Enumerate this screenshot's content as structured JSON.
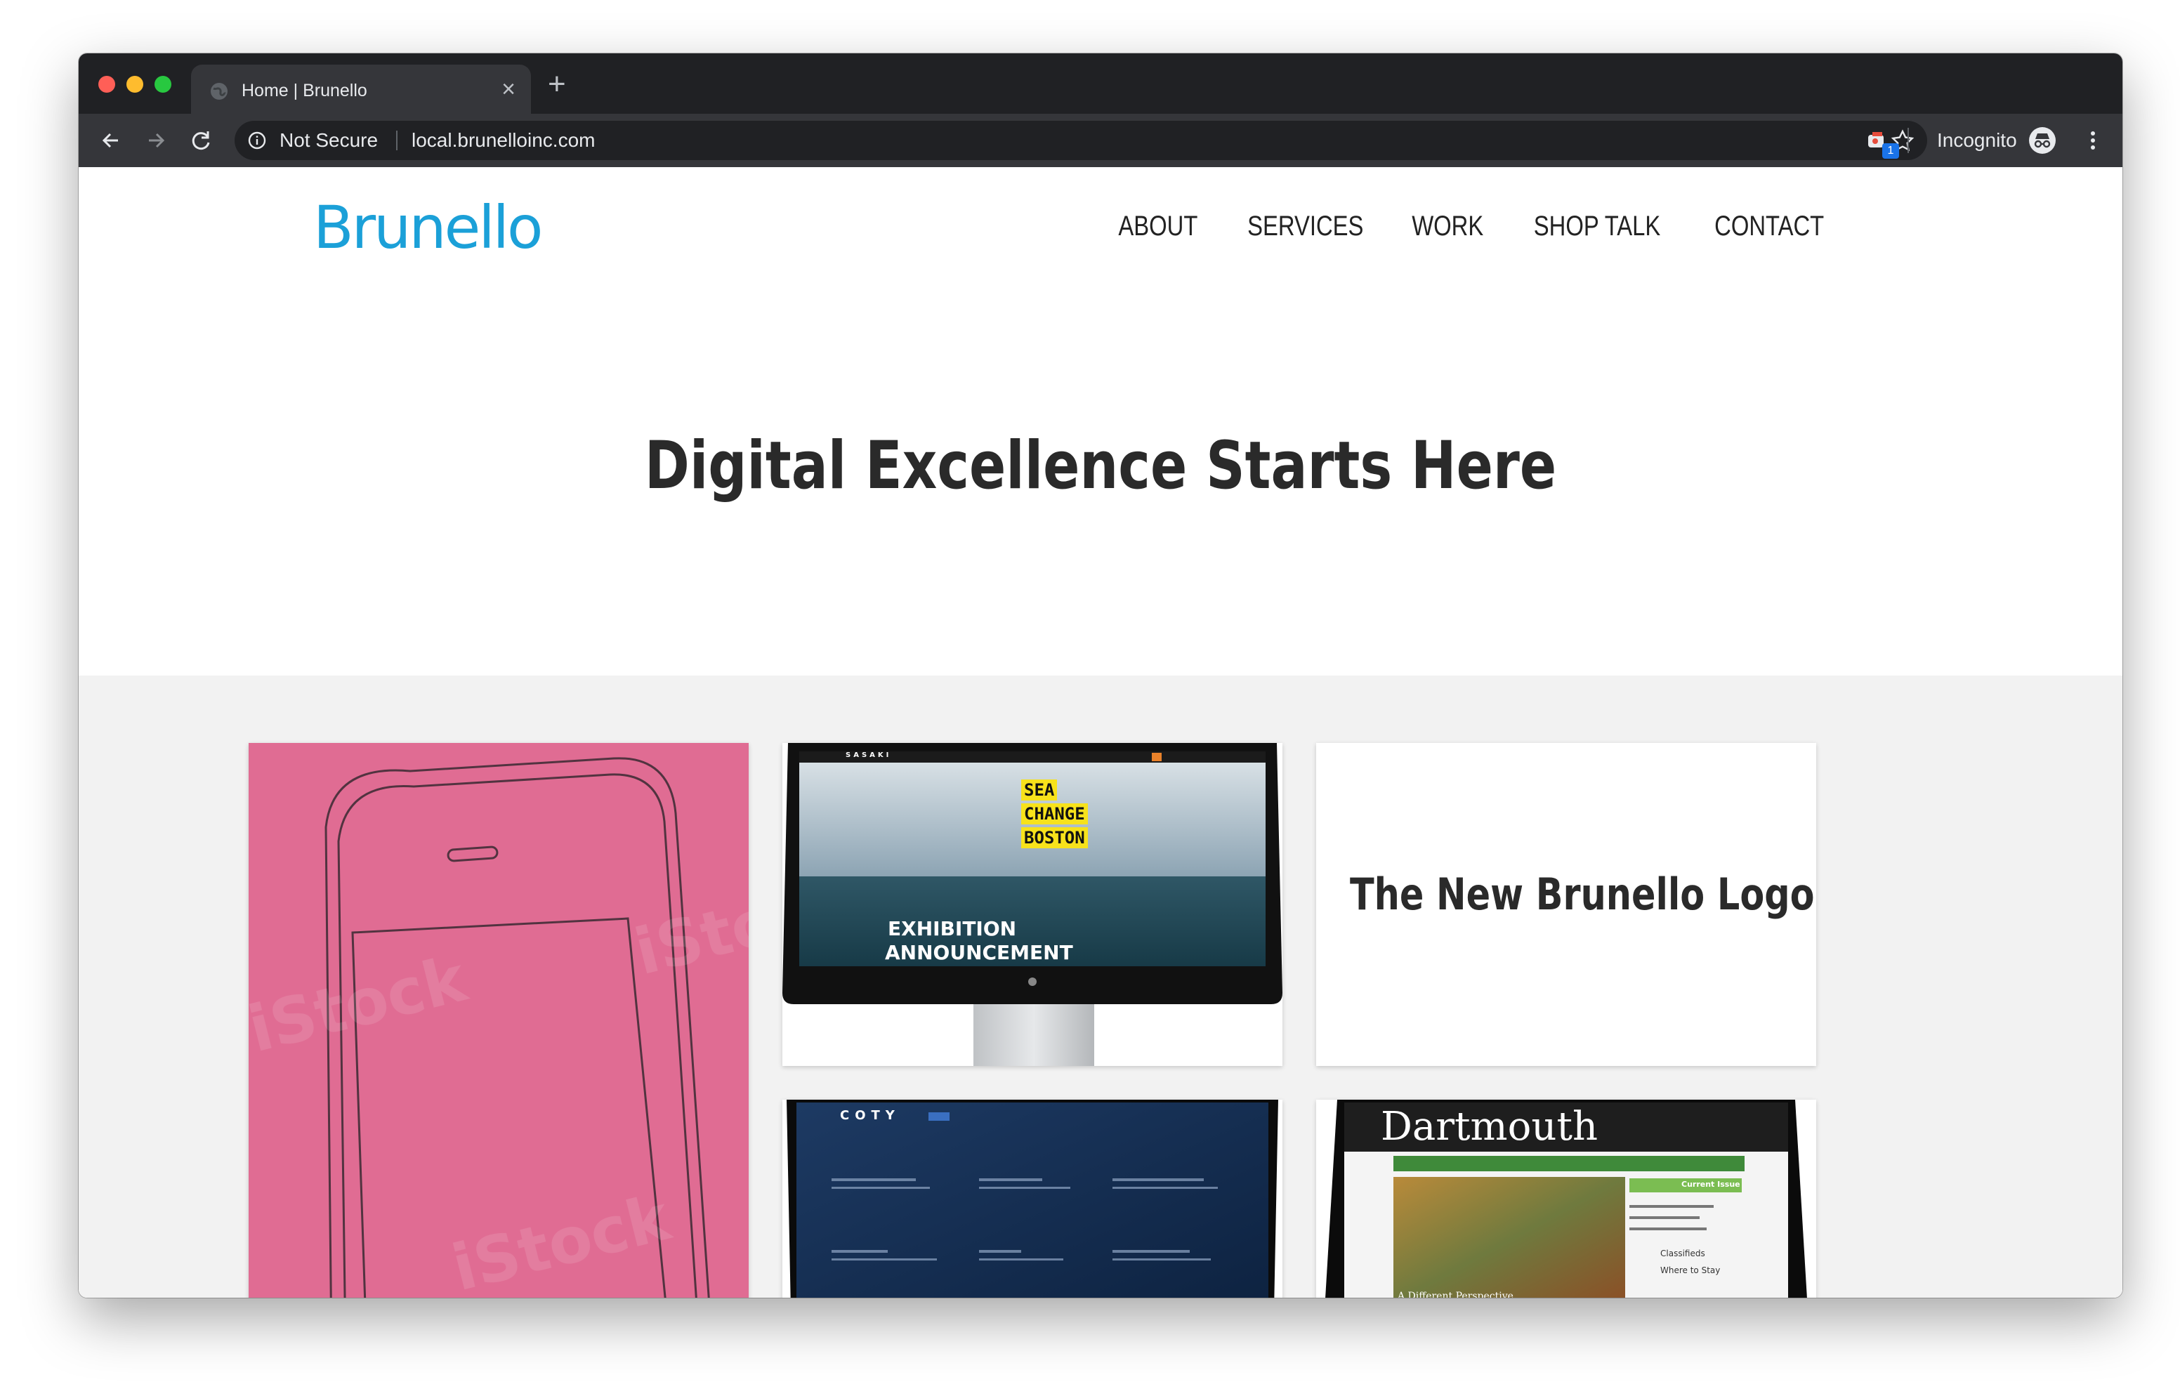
{
  "browser": {
    "tab_title": "Home | Brunello",
    "security_label": "Not Secure",
    "url": "local.brunelloinc.com",
    "extension_badge": "1",
    "profile_label": "Incognito"
  },
  "site": {
    "logo": "Brunello",
    "nav": [
      "ABOUT",
      "SERVICES",
      "WORK",
      "SHOP TALK",
      "CONTACT"
    ],
    "hero_title": "Digital Excellence Starts Here",
    "cards": {
      "sasaki": {
        "tags": [
          "SEA",
          "CHANGE",
          "BOSTON"
        ],
        "caption_line1": "EXHIBITION",
        "caption_line2": "ANNOUNCEMENT",
        "site_name": "SASAKI"
      },
      "logo_card_title": "The New Brunello Logo",
      "coty": {
        "brand": "COTY"
      },
      "dartmouth": {
        "title": "Dartmouth",
        "sidebar_title": "Current Issue",
        "links": [
          "Classifieds",
          "Where to Stay"
        ],
        "caption": "A Different Perspective"
      }
    }
  },
  "colors": {
    "brand_blue": "#1ba0d8",
    "pink_card": "#e06c93",
    "gray_band": "#f2f2f2",
    "chrome_dark": "#202124"
  }
}
